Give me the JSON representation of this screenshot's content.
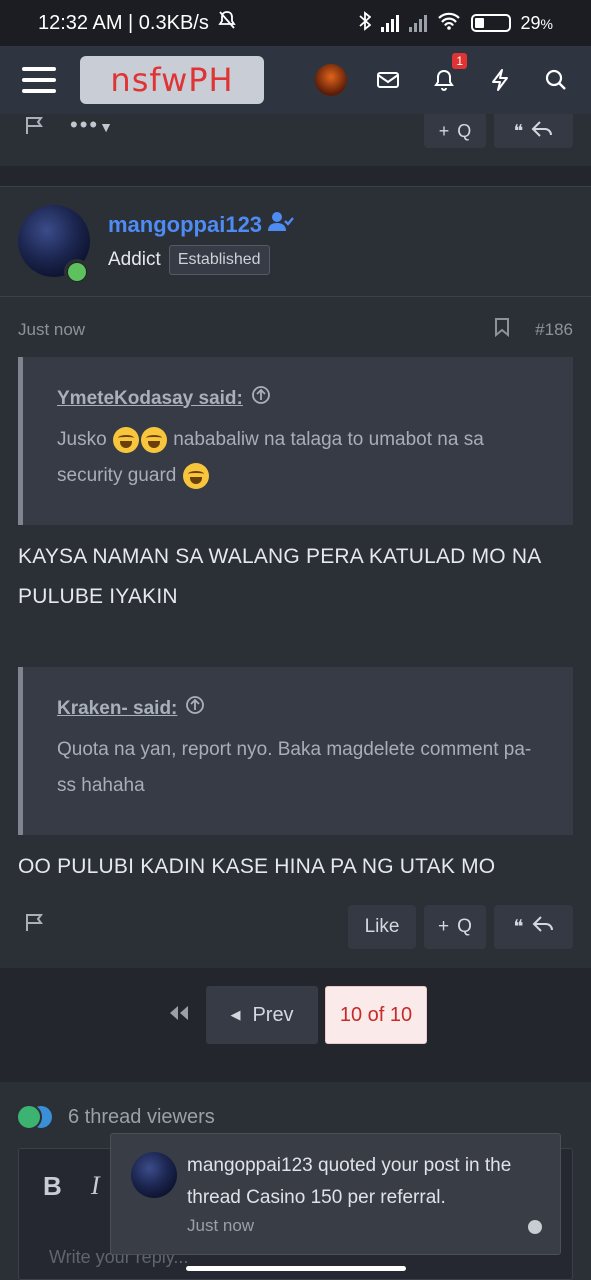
{
  "status_bar": {
    "time_speed": "12:32 AM | 0.3KB/s",
    "battery": "29",
    "battery_suffix": "%"
  },
  "nav": {
    "logo": "nsfwPH",
    "alert_count": "1"
  },
  "prev_post": {
    "quote_label": "Q"
  },
  "post": {
    "username": "mangoppai123",
    "user_title": "Addict",
    "user_banner": "Established",
    "time": "Just now",
    "post_number": "#186",
    "quote1": {
      "author": "YmeteKodasay said:",
      "text_part1": "Jusko",
      "text_part2": " nababaliw na talaga to umabot na sa security guard"
    },
    "reply1": "KAYSA NAMAN SA WALANG PERA KATULAD MO NA PULUBE IYAKIN",
    "quote2": {
      "author": "Kraken- said:",
      "text": "Quota na yan, report nyo. Baka magdelete comment pa-ss hahaha"
    },
    "reply2": "OO PULUBI KADIN KASE HINA PA NG UTAK MO",
    "like_label": "Like",
    "quote_label": "Q"
  },
  "pagination": {
    "prev_label": "Prev",
    "current": "10 of 10"
  },
  "viewers": {
    "text": "6 thread viewers"
  },
  "editor": {
    "bold": "B",
    "italic": "I",
    "placeholder": "Write your reply..."
  },
  "toast": {
    "message": "mangoppai123 quoted your post in the thread Casino 150 per referral.",
    "time": "Just now"
  },
  "colors": {
    "username_blue": "#4e8cf4",
    "logo_red": "#e03333",
    "online_green": "#5dc25d",
    "viewer_green": "#3cb371",
    "viewer_blue": "#3a8fd6"
  }
}
